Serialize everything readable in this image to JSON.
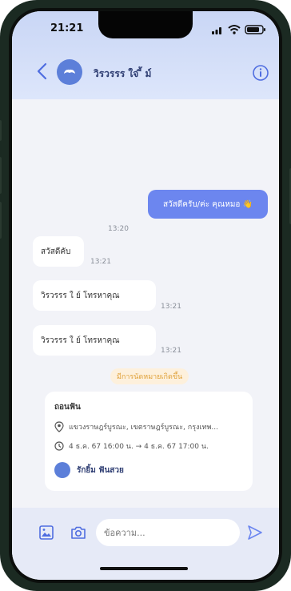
{
  "status_bar": {
    "time": "21:21"
  },
  "header": {
    "contact_name": "วิรวรรร ใจ ี้ ม์"
  },
  "messages": [
    {
      "direction": "out",
      "text": "สวัสดีครับ/ค่ะ คุณหมอ 👋",
      "time": "13:20"
    },
    {
      "direction": "in",
      "text": "สวัสดีคับ",
      "time": "13:21"
    },
    {
      "direction": "in",
      "text": "วิรวรรร ใ  ย์ โทรหาคุณ",
      "time": "13:21"
    },
    {
      "direction": "in",
      "text": "วิรวรรร ใ  ย์ โทรหาคุณ",
      "time": "13:21"
    }
  ],
  "appointment_notice": "มีการนัดหมายเกิดขึ้น",
  "appointment_card": {
    "title": "ถอนฟัน",
    "location": "แขวงราษฎร์บูรณะ, เขตราษฎร์บูรณะ, กรุงเทพ...",
    "time_range": "4 ธ.ค. 67 16:00 น. → 4 ธ.ค. 67 17:00 น.",
    "provider": "รักยิ้ม ฟันสวย"
  },
  "composer": {
    "placeholder": "ข้อความ..."
  }
}
